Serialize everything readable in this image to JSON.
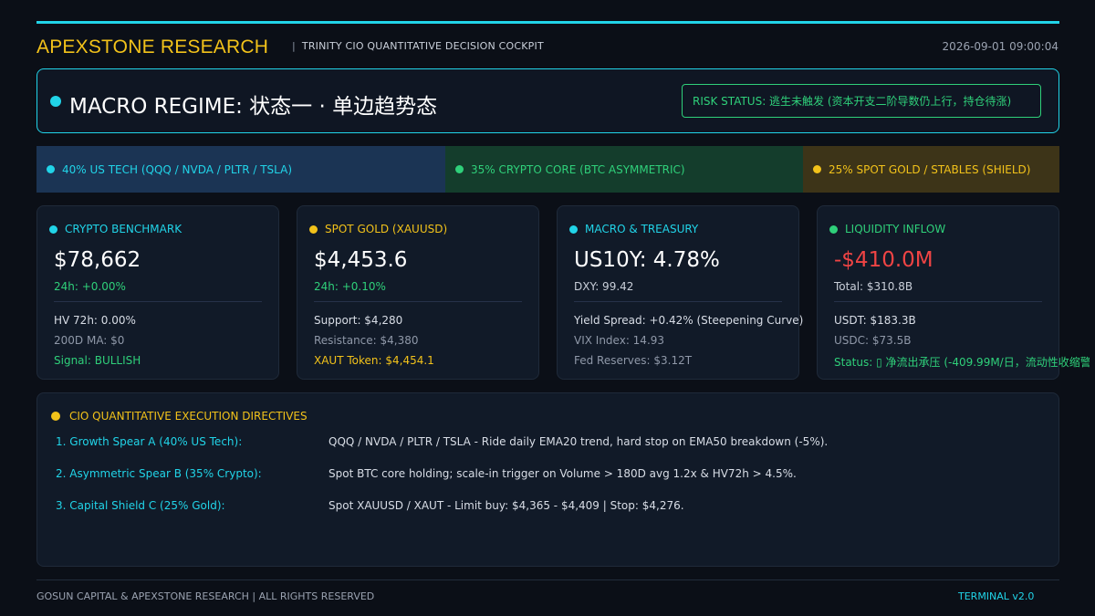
{
  "header": {
    "brand": "APEXSTONE RESEARCH",
    "separator": "|",
    "subtitle": "TRINITY CIO QUANTITATIVE DECISION COCKPIT",
    "timestamp": "2026-09-01 09:00:04"
  },
  "regime": {
    "title": "MACRO REGIME: 状态一 · 单边趋势态",
    "risk_status": "RISK STATUS: 逃生未触发 (资本开支二阶导数仍上行，持仓待涨)"
  },
  "allocations": [
    {
      "label": "40% US TECH (QQQ / NVDA / PLTR / TSLA)",
      "color": "#21d4e8"
    },
    {
      "label": "35% CRYPTO CORE (BTC ASYMMETRIC)",
      "color": "#2fd07a"
    },
    {
      "label": "25% SPOT GOLD / STABLES (SHIELD)",
      "color": "#f2c21a"
    }
  ],
  "cards": {
    "crypto": {
      "title": "CRYPTO BENCHMARK",
      "price": "$78,662",
      "change": "24h: +0.00%",
      "line1": "HV 72h: 0.00%",
      "line2": "200D MA: $0",
      "line3": "Signal: BULLISH"
    },
    "gold": {
      "title": "SPOT GOLD (XAUUSD)",
      "price": "$4,453.6",
      "change": "24h: +0.10%",
      "line1": "Support: $4,280",
      "line2": "Resistance: $4,380",
      "line3": "XAUT Token: $4,454.1"
    },
    "macro": {
      "title": "MACRO & TREASURY",
      "price": "US10Y: 4.78%",
      "change": "DXY: 99.42",
      "line1": "Yield Spread: +0.42% (Steepening Curve)",
      "line2": "VIX Index: 14.93",
      "line3": "Fed Reserves: $3.12T"
    },
    "liquidity": {
      "title": "LIQUIDITY INFLOW",
      "price": "-$410.0M",
      "change": "Total: $310.8B",
      "line1": "USDT: $183.3B",
      "line2": "USDC: $73.5B",
      "line3": "Status: ▯ 净流出承压 (-409.99M/日，流动性收缩警"
    }
  },
  "directives": {
    "title": "CIO QUANTITATIVE EXECUTION DIRECTIVES",
    "items": [
      {
        "label": "1. Growth Spear A (40% US Tech):",
        "text": "QQQ / NVDA / PLTR / TSLA - Ride daily EMA20 trend, hard stop on EMA50 breakdown (-5%)."
      },
      {
        "label": "2. Asymmetric Spear B (35% Crypto):",
        "text": "Spot BTC core holding; scale-in trigger on Volume > 180D avg 1.2x & HV72h > 4.5%."
      },
      {
        "label": "3. Capital Shield C (25% Gold):",
        "text": "Spot XAUUSD / XAUT - Limit buy: $4,365 - $4,409 | Stop: $4,276."
      }
    ]
  },
  "footer": {
    "left": "GOSUN CAPITAL & APEXSTONE RESEARCH | ALL RIGHTS RESERVED",
    "right": "TERMINAL v2.0"
  },
  "colors": {
    "accent_cyan": "#21d4e8",
    "accent_gold": "#f2c21a",
    "accent_green": "#2fd07a",
    "negative_red": "#ef4444",
    "background": "#0b0f17"
  }
}
